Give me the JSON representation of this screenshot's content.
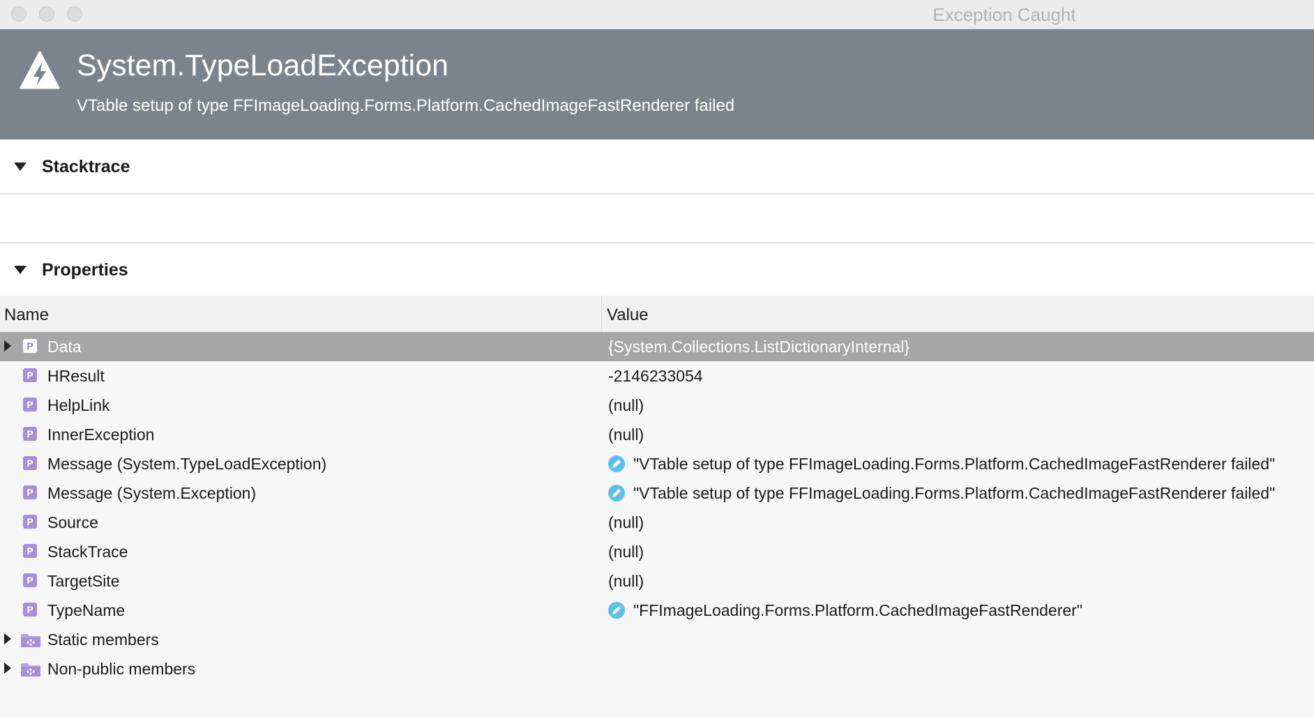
{
  "window": {
    "title": "Exception Caught"
  },
  "exception": {
    "type": "System.TypeLoadException",
    "message": "VTable setup of type FFImageLoading.Forms.Platform.CachedImageFastRenderer failed"
  },
  "stacktrace": {
    "title": "Stacktrace"
  },
  "properties": {
    "title": "Properties",
    "columns": {
      "name": "Name",
      "value": "Value"
    },
    "rows": [
      {
        "name": "Data",
        "value": "{System.Collections.ListDictionaryInternal}",
        "icon": "property-icon",
        "expandable": true,
        "selected": true,
        "editable": false
      },
      {
        "name": "HResult",
        "value": "-2146233054",
        "icon": "property-icon",
        "expandable": false,
        "selected": false,
        "editable": false
      },
      {
        "name": "HelpLink",
        "value": "(null)",
        "icon": "property-icon",
        "expandable": false,
        "selected": false,
        "editable": false
      },
      {
        "name": "InnerException",
        "value": "(null)",
        "icon": "property-icon",
        "expandable": false,
        "selected": false,
        "editable": false
      },
      {
        "name": "Message (System.TypeLoadException)",
        "value": "\"VTable setup of type FFImageLoading.Forms.Platform.CachedImageFastRenderer failed\"",
        "icon": "property-icon",
        "expandable": false,
        "selected": false,
        "editable": true
      },
      {
        "name": "Message (System.Exception)",
        "value": "\"VTable setup of type FFImageLoading.Forms.Platform.CachedImageFastRenderer failed\"",
        "icon": "property-icon",
        "expandable": false,
        "selected": false,
        "editable": true
      },
      {
        "name": "Source",
        "value": "(null)",
        "icon": "property-icon",
        "expandable": false,
        "selected": false,
        "editable": false
      },
      {
        "name": "StackTrace",
        "value": "(null)",
        "icon": "property-icon",
        "expandable": false,
        "selected": false,
        "editable": false
      },
      {
        "name": "TargetSite",
        "value": "(null)",
        "icon": "property-icon",
        "expandable": false,
        "selected": false,
        "editable": false
      },
      {
        "name": "TypeName",
        "value": "\"FFImageLoading.Forms.Platform.CachedImageFastRenderer\"",
        "icon": "property-icon",
        "expandable": false,
        "selected": false,
        "editable": true
      },
      {
        "name": "Static members",
        "value": "",
        "icon": "folder-icon",
        "expandable": true,
        "selected": false,
        "editable": false
      },
      {
        "name": "Non-public members",
        "value": "",
        "icon": "folder-icon",
        "expandable": true,
        "selected": false,
        "editable": false
      }
    ]
  },
  "colors": {
    "header_bg": "#7b838c",
    "selected_row": "#a6a6a6",
    "property_icon": "#a58fd6",
    "edit_icon": "#5bc0eb"
  }
}
